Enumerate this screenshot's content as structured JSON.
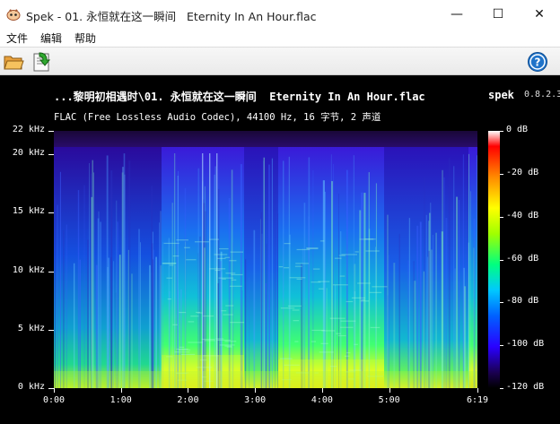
{
  "window": {
    "title": "Spek - 01. 永恒就在这一瞬间   Eternity In An Hour.flac",
    "minimize": "—",
    "maximize": "☐",
    "close": "✕"
  },
  "menu": {
    "file": "文件",
    "edit": "编辑",
    "help": "帮助"
  },
  "viewer": {
    "file_line": "...黎明初相遇时\\01. 永恒就在这一瞬间  Eternity In An Hour.flac",
    "app_label": "spek",
    "app_version": "0.8.2.3",
    "info_line": "FLAC (Free Lossless Audio Codec), 44100 Hz, 16 字节, 2 声道"
  },
  "chart_data": {
    "type": "heatmap",
    "title": "...黎明初相遇时\\01. 永恒就在这一瞬间  Eternity In An Hour.flac",
    "x_ticks": [
      "0:00",
      "1:00",
      "2:00",
      "3:00",
      "4:00",
      "5:00",
      "6:19"
    ],
    "x_tick_seconds": [
      0,
      60,
      120,
      180,
      240,
      300,
      379
    ],
    "xlim": [
      0,
      379
    ],
    "y_ticks": [
      "0 kHz",
      "5 kHz",
      "10 kHz",
      "15 kHz",
      "20 kHz",
      "22 kHz"
    ],
    "y_tick_khz": [
      0,
      5,
      10,
      15,
      20,
      22
    ],
    "ylim": [
      0,
      22
    ],
    "colorbar_ticks": [
      "0 dB",
      "-20 dB",
      "-40 dB",
      "-60 dB",
      "-80 dB",
      "-100 dB",
      "-120 dB"
    ],
    "colorbar_db": [
      0,
      -20,
      -40,
      -60,
      -80,
      -100,
      -120
    ],
    "colorbar_range": [
      -120,
      0
    ]
  },
  "icons": {
    "open": "folder-open-icon",
    "save": "save-icon",
    "about": "help-icon"
  }
}
